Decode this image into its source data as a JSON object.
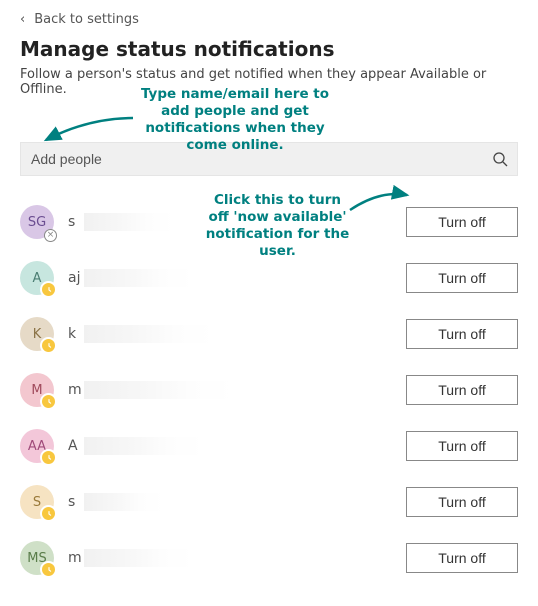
{
  "back_label": "Back to settings",
  "title": "Manage status notifications",
  "subtitle": "Follow a person's status and get notified when they appear Available or Offline.",
  "search": {
    "placeholder": "Add people"
  },
  "turn_off_label": "Turn off",
  "annotations": {
    "add": "Type name/email here to add people and get notifications when they come online.",
    "button": "Click this to turn off 'now available' notification for the user."
  },
  "people": [
    {
      "initials": "SG",
      "prefix": "s",
      "bg": "#d9c7e6",
      "fg": "#6b4d91",
      "presence": "offline",
      "blur_w": 90
    },
    {
      "initials": "A",
      "prefix": "aj",
      "bg": "#c7e6df",
      "fg": "#4a7d72",
      "presence": "away",
      "blur_w": 110
    },
    {
      "initials": "K",
      "prefix": "k",
      "bg": "#e6dac7",
      "fg": "#8a7245",
      "presence": "away",
      "blur_w": 130
    },
    {
      "initials": "M",
      "prefix": "m",
      "bg": "#f3c7cf",
      "fg": "#a04a5c",
      "presence": "away",
      "blur_w": 150
    },
    {
      "initials": "AA",
      "prefix": "A",
      "bg": "#f3c7d9",
      "fg": "#a04a7a",
      "presence": "away",
      "blur_w": 120
    },
    {
      "initials": "S",
      "prefix": "s",
      "bg": "#f6e3c2",
      "fg": "#9a7a3a",
      "presence": "away",
      "blur_w": 80
    },
    {
      "initials": "MS",
      "prefix": "m",
      "bg": "#cfe0c7",
      "fg": "#5a7d4a",
      "presence": "away",
      "blur_w": 110
    }
  ]
}
